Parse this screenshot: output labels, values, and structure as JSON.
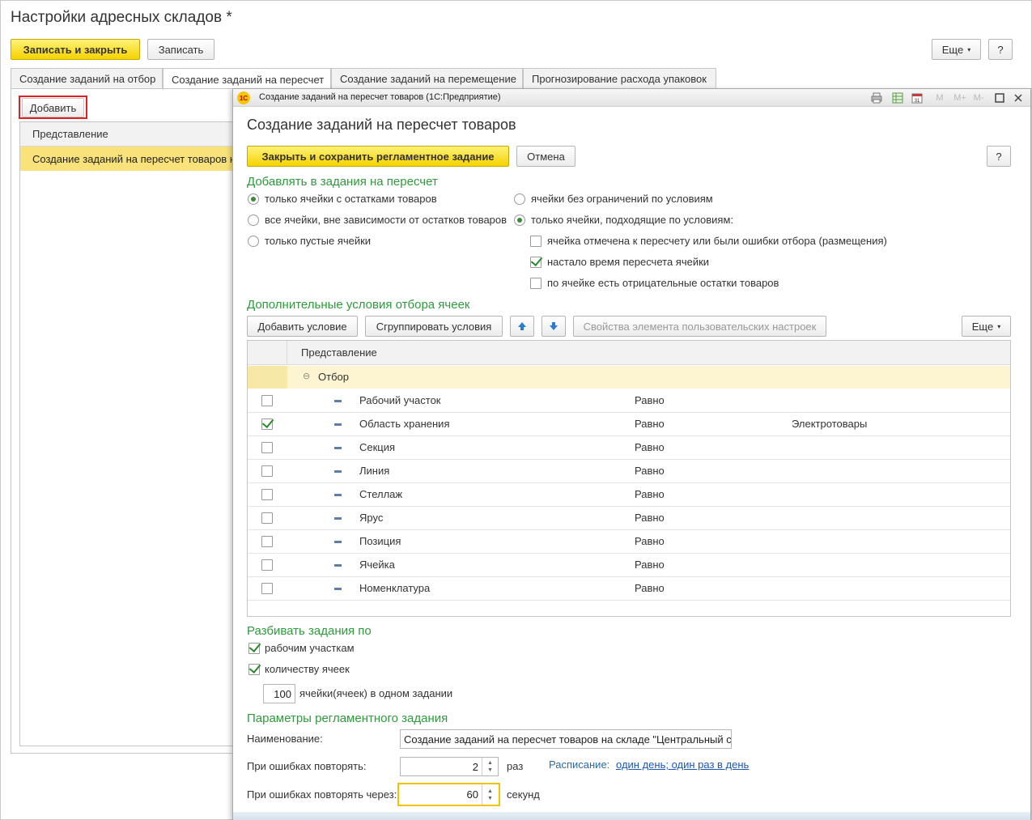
{
  "window": {
    "title": "Настройки адресных складов *"
  },
  "toolbar": {
    "save_close": "Записать и закрыть",
    "save": "Записать",
    "more": "Еще",
    "help": "?"
  },
  "tabs": [
    {
      "label": "Создание заданий на отбор"
    },
    {
      "label": "Создание заданий на пересчет"
    },
    {
      "label": "Создание заданий на перемещение"
    },
    {
      "label": "Прогнозирование расхода упаковок"
    }
  ],
  "left": {
    "add": "Добавить",
    "column": "Представление",
    "rows": [
      "Создание заданий на пересчет товаров н"
    ]
  },
  "dialog": {
    "title": "Создание заданий на пересчет товаров  (1С:Предприятие)",
    "logo": "1С",
    "titlebar_icons": [
      "print-icon",
      "table-icon",
      "calendar-icon",
      "M",
      "M+",
      "M-",
      "maximize-icon",
      "close-icon"
    ],
    "heading": "Создание заданий на пересчет товаров",
    "close_save": "Закрыть и сохранить регламентное задание",
    "cancel": "Отмена",
    "help": "?",
    "section_add": "Добавлять в задания на пересчет",
    "radios_left": [
      {
        "label": "только ячейки с остатками товаров",
        "checked": true
      },
      {
        "label": "все ячейки, вне зависимости от остатков товаров",
        "checked": false
      },
      {
        "label": "только пустые ячейки",
        "checked": false
      }
    ],
    "radios_right": [
      {
        "label": "ячейки без ограничений по условиям",
        "checked": false
      },
      {
        "label": "только ячейки, подходящие по условиям:",
        "checked": true
      }
    ],
    "conditions": [
      {
        "label": "ячейка отмечена к пересчету или были ошибки отбора (размещения)",
        "checked": false
      },
      {
        "label": "настало время пересчета ячейки",
        "checked": true
      },
      {
        "label": "по ячейке есть отрицательные остатки товаров",
        "checked": false
      }
    ],
    "section_extra": "Дополнительные условия отбора ячеек",
    "add_condition": "Добавить условие",
    "group_conditions": "Сгруппировать условия",
    "up_icon": "arrow-up-icon",
    "down_icon": "arrow-down-icon",
    "props": "Свойства элемента пользовательских настроек",
    "more": "Еще",
    "grid_header": "Представление",
    "group_label": "Отбор",
    "filters": [
      {
        "name": "Рабочий участок",
        "op": "Равно",
        "value": "",
        "checked": false
      },
      {
        "name": "Область хранения",
        "op": "Равно",
        "value": "Электротовары",
        "checked": true
      },
      {
        "name": "Секция",
        "op": "Равно",
        "value": "",
        "checked": false
      },
      {
        "name": "Линия",
        "op": "Равно",
        "value": "",
        "checked": false
      },
      {
        "name": "Стеллаж",
        "op": "Равно",
        "value": "",
        "checked": false
      },
      {
        "name": "Ярус",
        "op": "Равно",
        "value": "",
        "checked": false
      },
      {
        "name": "Позиция",
        "op": "Равно",
        "value": "",
        "checked": false
      },
      {
        "name": "Ячейка",
        "op": "Равно",
        "value": "",
        "checked": false
      },
      {
        "name": "Номенклатура",
        "op": "Равно",
        "value": "",
        "checked": false
      }
    ],
    "section_split": "Разбивать задания по",
    "split_options": [
      {
        "label": "рабочим участкам",
        "checked": true
      },
      {
        "label": "количеству ячеек",
        "checked": true
      }
    ],
    "cells_count": "100",
    "cells_label": "ячейки(ячеек) в одном задании",
    "section_params": "Параметры регламентного задания",
    "name_label": "Наименование:",
    "name_value": "Создание заданий на пересчет товаров на складе \"Центральный с",
    "retry_label": "При ошибках повторять:",
    "retry_value": "2",
    "retry_unit": "раз",
    "schedule_label": "Расписание:",
    "schedule_link": "один день; один раз в день",
    "retry_after_label": "При ошибках повторять через:",
    "retry_after_value": "60",
    "retry_after_unit": "секунд"
  }
}
